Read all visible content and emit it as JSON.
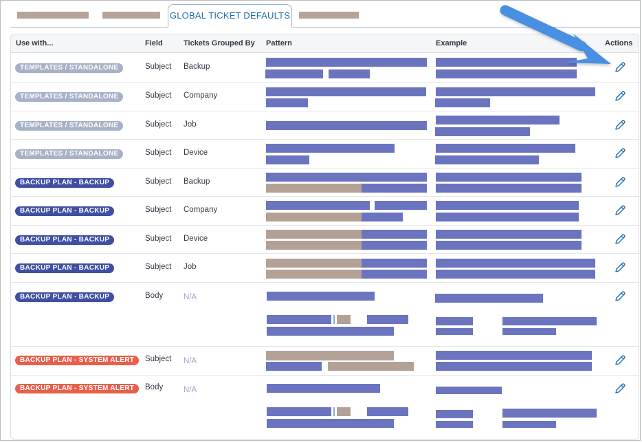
{
  "tabs": {
    "active_label": "GLOBAL TICKET DEFAULTS"
  },
  "table": {
    "headers": {
      "use_with": "Use with...",
      "field": "Field",
      "grouped_by": "Tickets Grouped By",
      "pattern": "Pattern",
      "example": "Example",
      "actions": "Actions"
    },
    "rows": [
      {
        "use_with": "TEMPLATES / STANDALONE",
        "field": "Subject",
        "grouped_by": "Backup"
      },
      {
        "use_with": "TEMPLATES / STANDALONE",
        "field": "Subject",
        "grouped_by": "Company"
      },
      {
        "use_with": "TEMPLATES / STANDALONE",
        "field": "Subject",
        "grouped_by": "Job"
      },
      {
        "use_with": "TEMPLATES / STANDALONE",
        "field": "Subject",
        "grouped_by": "Device"
      },
      {
        "use_with": "BACKUP PLAN - BACKUP",
        "field": "Subject",
        "grouped_by": "Backup"
      },
      {
        "use_with": "BACKUP PLAN - BACKUP",
        "field": "Subject",
        "grouped_by": "Company"
      },
      {
        "use_with": "BACKUP PLAN - BACKUP",
        "field": "Subject",
        "grouped_by": "Device"
      },
      {
        "use_with": "BACKUP PLAN - BACKUP",
        "field": "Subject",
        "grouped_by": "Job"
      },
      {
        "use_with": "BACKUP PLAN - BACKUP",
        "field": "Body",
        "grouped_by": "N/A"
      },
      {
        "use_with": "BACKUP PLAN - SYSTEM ALERT",
        "field": "Subject",
        "grouped_by": "N/A"
      },
      {
        "use_with": "BACKUP PLAN - SYSTEM ALERT",
        "field": "Body",
        "grouped_by": "N/A"
      }
    ]
  },
  "icons": {
    "edit": "pencil-icon",
    "annotation": "arrow-pointer"
  },
  "colors": {
    "accent": "#1f6fae",
    "badge_templates": "#a8b2c6",
    "badge_backup": "#3f4fa2",
    "badge_alert": "#e8604a",
    "arrow": "#4a90e2"
  }
}
